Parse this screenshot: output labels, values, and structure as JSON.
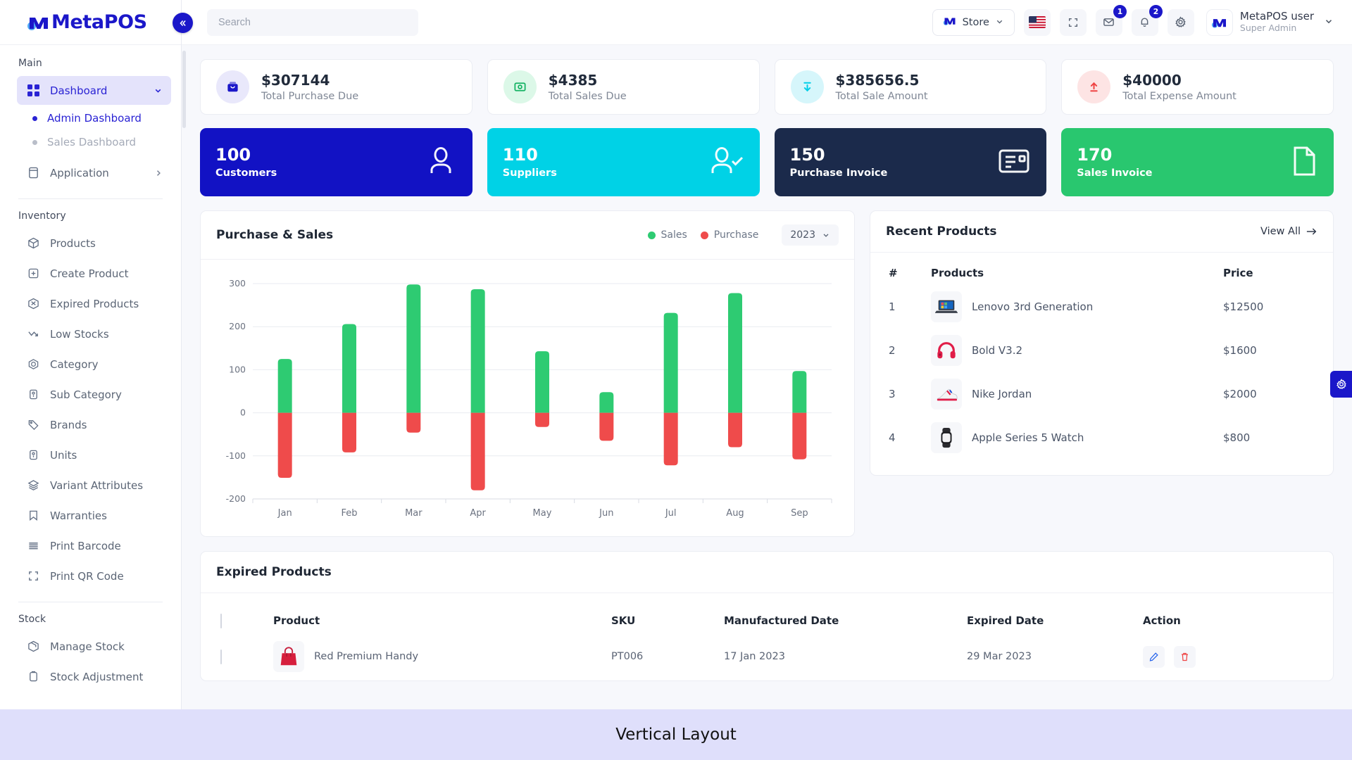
{
  "brand": {
    "name_meta": "Meta",
    "name_pos": "POS",
    "full": "MetaPOS"
  },
  "topbar": {
    "search_placeholder": "Search",
    "store_label": "Store",
    "store_icon": "metapos-logo-icon",
    "flag_icon": "us-flag-icon",
    "fullscreen_icon": "fullscreen-icon",
    "mail_icon": "mail-icon",
    "mail_badge": "1",
    "bell_icon": "bell-icon",
    "bell_badge": "2",
    "settings_icon": "gear-icon",
    "user_name": "MetaPOS user",
    "user_role": "Super Admin",
    "collapse_icon": "double-chevron-left-icon"
  },
  "sidebar": {
    "sections": [
      {
        "title": "Main",
        "items": [
          {
            "label": "Dashboard",
            "icon": "grid-icon",
            "active": true,
            "expandable": true,
            "children": [
              {
                "label": "Admin Dashboard",
                "selected": true
              },
              {
                "label": "Sales Dashboard",
                "selected": false
              }
            ]
          },
          {
            "label": "Application",
            "icon": "window-icon",
            "active": false,
            "expandable": true,
            "children": []
          }
        ]
      },
      {
        "title": "Inventory",
        "items": [
          {
            "label": "Products",
            "icon": "box-icon"
          },
          {
            "label": "Create Product",
            "icon": "plus-square-icon"
          },
          {
            "label": "Expired Products",
            "icon": "box-expired-icon"
          },
          {
            "label": "Low Stocks",
            "icon": "trend-down-icon"
          },
          {
            "label": "Category",
            "icon": "category-icon"
          },
          {
            "label": "Sub Category",
            "icon": "sub-category-icon"
          },
          {
            "label": "Brands",
            "icon": "tag-icon"
          },
          {
            "label": "Units",
            "icon": "units-icon"
          },
          {
            "label": "Variant Attributes",
            "icon": "layers-icon"
          },
          {
            "label": "Warranties",
            "icon": "bookmark-icon"
          },
          {
            "label": "Print Barcode",
            "icon": "barcode-icon"
          },
          {
            "label": "Print QR Code",
            "icon": "qr-code-icon"
          }
        ]
      },
      {
        "title": "Stock",
        "items": [
          {
            "label": "Manage Stock",
            "icon": "package-icon"
          },
          {
            "label": "Stock Adjustment",
            "icon": "clipboard-icon"
          }
        ]
      }
    ]
  },
  "stats": [
    {
      "value": "$307144",
      "label": "Total Purchase Due",
      "icon": "briefcase-icon",
      "bg": "#e9e8fb",
      "fg": "#1b17c9"
    },
    {
      "value": "$4385",
      "label": "Total Sales Due",
      "icon": "cash-icon",
      "bg": "#dcf8e8",
      "fg": "#16b364"
    },
    {
      "value": "$385656.5",
      "label": "Total Sale Amount",
      "icon": "arrow-down-icon",
      "bg": "#d6f6fb",
      "fg": "#00cfe8"
    },
    {
      "value": "$40000",
      "label": "Total Expense Amount",
      "icon": "arrow-up-icon",
      "bg": "#fde4e4",
      "fg": "#ef4444"
    }
  ],
  "tiles": [
    {
      "count": "100",
      "label": "Customers",
      "icon": "user-icon",
      "color": "#1212c4"
    },
    {
      "count": "110",
      "label": "Suppliers",
      "icon": "user-check-icon",
      "color": "#00d2e6"
    },
    {
      "count": "150",
      "label": "Purchase Invoice",
      "icon": "invoice-icon",
      "color": "#1b2a4b"
    },
    {
      "count": "170",
      "label": "Sales Invoice",
      "icon": "file-icon",
      "color": "#29c76f"
    }
  ],
  "chart_panel": {
    "title": "Purchase & Sales",
    "legend": [
      {
        "name": "Sales",
        "color": "#2ecb72"
      },
      {
        "name": "Purchase",
        "color": "#ef4b4b"
      }
    ],
    "year": "2023",
    "year_chevron": "chevron-down-icon"
  },
  "chart_data": {
    "type": "bar",
    "title": "Purchase & Sales",
    "categories": [
      "Jan",
      "Feb",
      "Mar",
      "Apr",
      "May",
      "Jun",
      "Jul",
      "Aug",
      "Sep"
    ],
    "series": [
      {
        "name": "Sales",
        "color": "#2ecb72",
        "values": [
          125,
          206,
          298,
          287,
          143,
          48,
          232,
          278,
          97
        ]
      },
      {
        "name": "Purchase",
        "color": "#ef4b4b",
        "values": [
          -151,
          -92,
          -46,
          -180,
          -33,
          -65,
          -122,
          -80,
          -108
        ]
      }
    ],
    "ylim": [
      -200,
      300
    ],
    "yticks": [
      300,
      200,
      100,
      0,
      -100,
      -200
    ],
    "xlabel": "",
    "ylabel": "",
    "grid": true,
    "legend_position": "top-right",
    "stacked": true
  },
  "recent_products": {
    "title": "Recent Products",
    "view_all": "View All",
    "view_all_icon": "arrow-right-icon",
    "columns": [
      "#",
      "Products",
      "Price"
    ],
    "rows": [
      {
        "num": "1",
        "name": "Lenovo 3rd Generation",
        "price": "$12500",
        "thumb": "laptop-icon"
      },
      {
        "num": "2",
        "name": "Bold V3.2",
        "price": "$1600",
        "thumb": "headphones-icon"
      },
      {
        "num": "3",
        "name": "Nike Jordan",
        "price": "$2000",
        "thumb": "sneaker-icon"
      },
      {
        "num": "4",
        "name": "Apple Series 5 Watch",
        "price": "$800",
        "thumb": "watch-icon"
      }
    ]
  },
  "expired_products": {
    "title": "Expired Products",
    "columns": [
      "",
      "Product",
      "SKU",
      "Manufactured Date",
      "Expired Date",
      "Action"
    ],
    "rows": [
      {
        "product": "Red Premium Handy",
        "thumb": "handbag-icon",
        "sku": "PT006",
        "manufactured": "17 Jan 2023",
        "expired": "29 Mar 2023",
        "edit_icon": "edit-icon",
        "delete_icon": "trash-icon"
      }
    ]
  },
  "float_settings_icon": "gear-icon",
  "footer": {
    "text": "Vertical Layout"
  }
}
